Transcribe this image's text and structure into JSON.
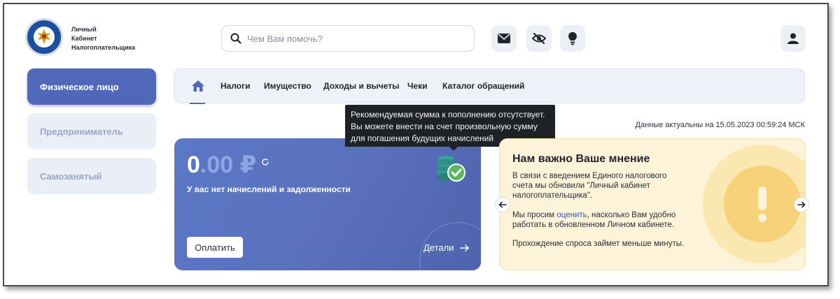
{
  "header": {
    "logo_lines": [
      "Личный",
      "Кабинет",
      "Налогоплательщика"
    ],
    "search_placeholder": "Чем Вам помочь?"
  },
  "header_icons": [
    "mail-icon",
    "eye-off-icon",
    "lightbulb-icon",
    "user-icon"
  ],
  "sidebar": {
    "items": [
      {
        "label": "Физическое лицо",
        "active": true
      },
      {
        "label": "Предприниматель",
        "active": false
      },
      {
        "label": "Самозанятый",
        "active": false
      }
    ]
  },
  "nav": {
    "items": [
      "Налоги",
      "Имущество",
      "Доходы и вычеты",
      "Чеки",
      "Каталог обращений"
    ]
  },
  "tooltip": {
    "lines": [
      "Рекомендуемая сумма к пополнению отсутствует.",
      "Вы можете внести на счет произвольную сумму",
      "для погашения будущих начислений"
    ]
  },
  "updated_text": "Данные актуальны на 15.05.2023 00:59:24 МСК",
  "balance": {
    "amount_int": "0",
    "amount_dec": ".00 ₽",
    "subtitle": "У вас нет начислений и задолженности",
    "pay_label": "Оплатить",
    "details_label": "Детали"
  },
  "opinion": {
    "title": "Нам важно Ваше мнение",
    "para1": [
      "В связи с введением Единого налогового",
      "счета мы обновили \"Личный кабинет",
      "налогоплательщика\"."
    ],
    "para2_prefix": "Мы просим ",
    "para2_link": "оценить",
    "para2_suffix": ", насколько Вам удобно",
    "para2_line2": "работать в обновленном Личном кабинете.",
    "para3": "Прохождение спроса займет меньше минуты."
  },
  "colors": {
    "accent": "#4f68b9",
    "card_bg": "#5b78c6",
    "opinion_bg": "#fdf3d9",
    "success": "#4caf50"
  }
}
